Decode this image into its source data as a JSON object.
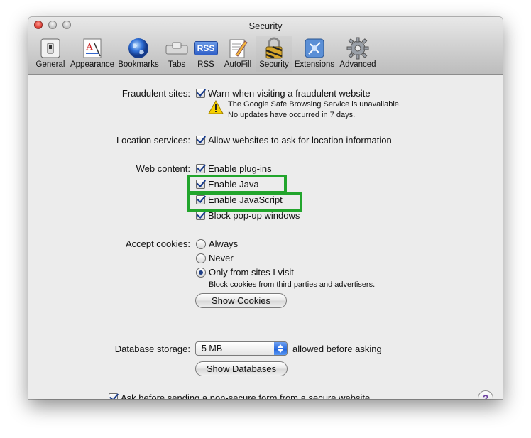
{
  "window": {
    "title": "Security"
  },
  "toolbar": {
    "items": [
      {
        "label": "General",
        "icon": "general-switch-icon"
      },
      {
        "label": "Appearance",
        "icon": "appearance-font-icon"
      },
      {
        "label": "Bookmarks",
        "icon": "globe-icon"
      },
      {
        "label": "Tabs",
        "icon": "tabs-icon"
      },
      {
        "label": "RSS",
        "icon": "rss-icon"
      },
      {
        "label": "AutoFill",
        "icon": "autofill-pencil-icon"
      },
      {
        "label": "Security",
        "icon": "lock-icon"
      },
      {
        "label": "Extensions",
        "icon": "extensions-icon"
      },
      {
        "label": "Advanced",
        "icon": "gear-icon"
      }
    ],
    "selected": "Security",
    "rss_badge": "RSS"
  },
  "fraudulent": {
    "label": "Fraudulent sites:",
    "option": "Warn when visiting a fraudulent website",
    "checked": true,
    "warning_line1": "The Google Safe Browsing Service is unavailable.",
    "warning_line2": "No updates have occurred in 7 days."
  },
  "location": {
    "label": "Location services:",
    "option": "Allow websites to ask for location information",
    "checked": true
  },
  "web_content": {
    "label": "Web content:",
    "options": [
      {
        "label": "Enable plug-ins",
        "checked": true
      },
      {
        "label": "Enable Java",
        "checked": true
      },
      {
        "label": "Enable JavaScript",
        "checked": true
      },
      {
        "label": "Block pop-up windows",
        "checked": true
      }
    ]
  },
  "cookies": {
    "label": "Accept cookies:",
    "options": [
      {
        "label": "Always",
        "selected": false
      },
      {
        "label": "Never",
        "selected": false
      },
      {
        "label": "Only from sites I visit",
        "selected": true
      }
    ],
    "note": "Block cookies from third parties and advertisers.",
    "button": "Show Cookies"
  },
  "database": {
    "label": "Database storage:",
    "value": "5 MB",
    "suffix": "allowed before asking",
    "button": "Show Databases"
  },
  "nonsecure": {
    "option": "Ask before sending a non-secure form from a secure website",
    "checked": true
  },
  "help": {
    "glyph": "?"
  },
  "colors": {
    "highlight": "#22a52c",
    "selection_blue": "#2f6fe0"
  }
}
